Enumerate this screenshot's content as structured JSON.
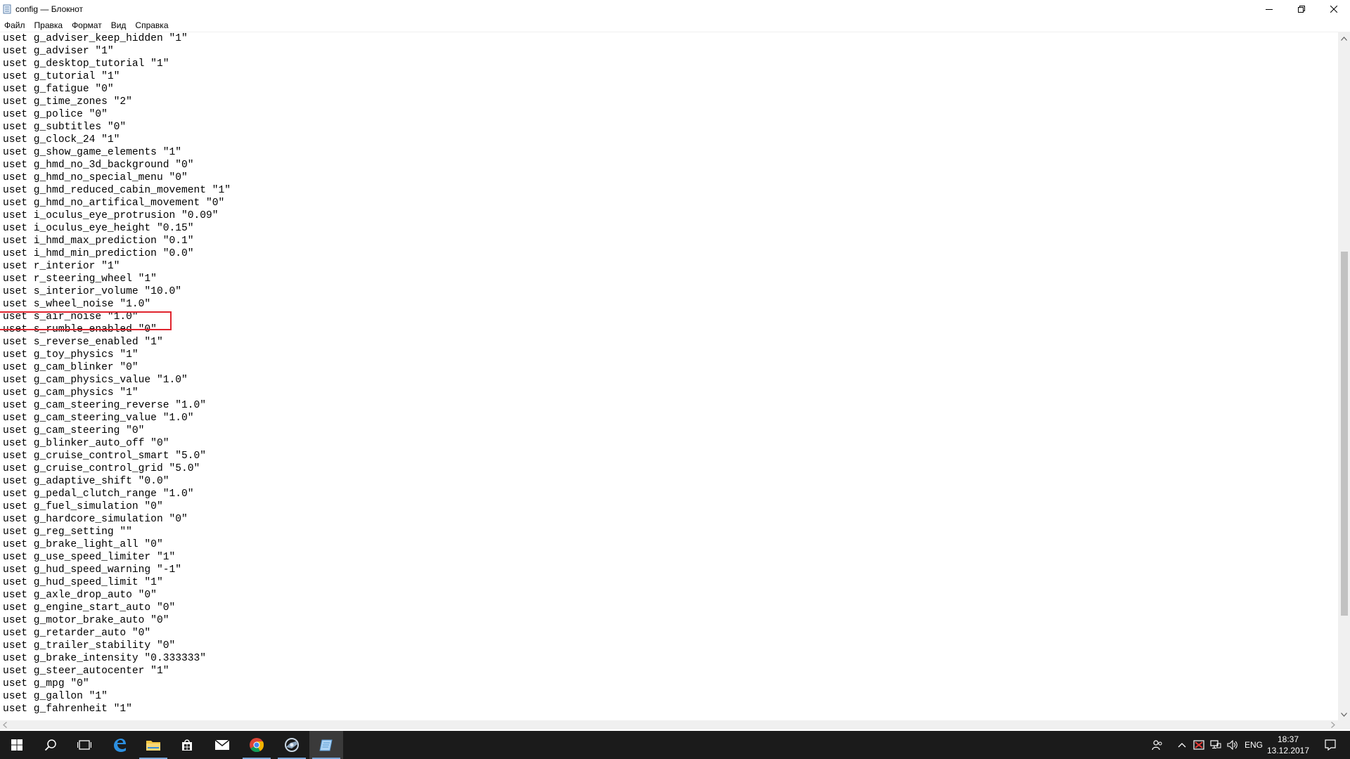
{
  "window": {
    "title": "config — Блокнот"
  },
  "menu": {
    "items": [
      "Файл",
      "Правка",
      "Формат",
      "Вид",
      "Справка"
    ]
  },
  "editor": {
    "lines": [
      "uset g_adviser_keep_hidden \"1\"",
      "uset g_adviser \"1\"",
      "uset g_desktop_tutorial \"1\"",
      "uset g_tutorial \"1\"",
      "uset g_fatigue \"0\"",
      "uset g_time_zones \"2\"",
      "uset g_police \"0\"",
      "uset g_subtitles \"0\"",
      "uset g_clock_24 \"1\"",
      "uset g_show_game_elements \"1\"",
      "uset g_hmd_no_3d_background \"0\"",
      "uset g_hmd_no_special_menu \"0\"",
      "uset g_hmd_reduced_cabin_movement \"1\"",
      "uset g_hmd_no_artifical_movement \"0\"",
      "uset i_oculus_eye_protrusion \"0.09\"",
      "uset i_oculus_eye_height \"0.15\"",
      "uset i_hmd_max_prediction \"0.1\"",
      "uset i_hmd_min_prediction \"0.0\"",
      "uset r_interior \"1\"",
      "uset r_steering_wheel \"1\"",
      "uset s_interior_volume \"10.0\"",
      "uset s_wheel_noise \"1.0\"",
      "uset s_air_noise \"1.0\"",
      "uset s_rumble_enabled \"0\"",
      "uset s_reverse_enabled \"1\"",
      "uset g_toy_physics \"1\"",
      "uset g_cam_blinker \"0\"",
      "uset g_cam_physics_value \"1.0\"",
      "uset g_cam_physics \"1\"",
      "uset g_cam_steering_reverse \"1.0\"",
      "uset g_cam_steering_value \"1.0\"",
      "uset g_cam_steering \"0\"",
      "uset g_blinker_auto_off \"0\"",
      "uset g_cruise_control_smart \"5.0\"",
      "uset g_cruise_control_grid \"5.0\"",
      "uset g_adaptive_shift \"0.0\"",
      "uset g_pedal_clutch_range \"1.0\"",
      "uset g_fuel_simulation \"0\"",
      "uset g_hardcore_simulation \"0\"",
      "uset g_reg_setting \"\"",
      "uset g_brake_light_all \"0\"",
      "uset g_use_speed_limiter \"1\"",
      "uset g_hud_speed_warning \"-1\"",
      "uset g_hud_speed_limit \"1\"",
      "uset g_axle_drop_auto \"0\"",
      "uset g_engine_start_auto \"0\"",
      "uset g_motor_brake_auto \"0\"",
      "uset g_retarder_auto \"0\"",
      "uset g_trailer_stability \"0\"",
      "uset g_brake_intensity \"0.333333\"",
      "uset g_steer_autocenter \"1\"",
      "uset g_mpg \"0\"",
      "uset g_gallon \"1\"",
      "uset g_fahrenheit \"1\""
    ]
  },
  "taskbar": {
    "language": "ENG",
    "time": "18:37",
    "date": "13.12.2017"
  },
  "colors": {
    "highlight": "#e0242e",
    "taskbar": "#1b1b1b"
  },
  "icons": [
    "notepad-icon",
    "minimize-icon",
    "maximize-icon",
    "close-icon",
    "windows-start-icon",
    "search-icon",
    "task-view-icon",
    "edge-icon",
    "file-explorer-icon",
    "store-icon",
    "mail-icon",
    "chrome-icon",
    "game-icon",
    "notepad-taskbar-icon",
    "people-icon",
    "chevron-up-icon",
    "antivirus-icon",
    "network-icon",
    "volume-icon",
    "action-center-icon"
  ]
}
